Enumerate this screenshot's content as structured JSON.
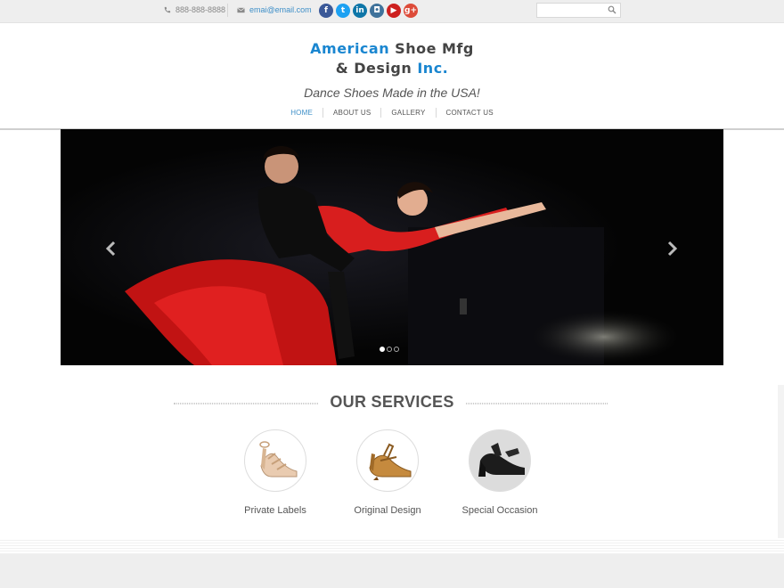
{
  "topbar": {
    "phone": "888-888-8888",
    "email": "emai@email.com",
    "social_icons": [
      {
        "name": "facebook-icon",
        "glyph": "f",
        "color": "#3b5998"
      },
      {
        "name": "twitter-icon",
        "glyph": "t",
        "color": "#1da1f2"
      },
      {
        "name": "linkedin-icon",
        "glyph": "in",
        "color": "#0e76a8"
      },
      {
        "name": "instagram-icon",
        "glyph": "◘",
        "color": "#3f729b"
      },
      {
        "name": "youtube-icon",
        "glyph": "▶",
        "color": "#cd201f"
      },
      {
        "name": "googleplus-icon",
        "glyph": "g+",
        "color": "#dd4b39"
      }
    ],
    "search_placeholder": ""
  },
  "header": {
    "logo_line1_a": "American",
    "logo_line1_b": "Shoe Mfg",
    "logo_line2_a": "& Design",
    "logo_line2_b": "Inc.",
    "tagline": "Dance Shoes Made in the USA!"
  },
  "nav": {
    "items": [
      {
        "label": "HOME",
        "active": true
      },
      {
        "label": "ABOUT US",
        "active": false
      },
      {
        "label": "GALLERY",
        "active": false
      },
      {
        "label": "CONTACT US",
        "active": false
      }
    ]
  },
  "slider": {
    "image": "ballroom-dance-couple-photo",
    "slide_count": 3,
    "active_slide": 1
  },
  "services": {
    "title": "OUR SERVICES",
    "items": [
      {
        "label": "Private Labels"
      },
      {
        "label": "Original Design"
      },
      {
        "label": "Special Occasion"
      }
    ]
  },
  "colors": {
    "accent": "#1a86d0",
    "link": "#3e8fc8",
    "topbar_bg": "#eeeeee"
  }
}
